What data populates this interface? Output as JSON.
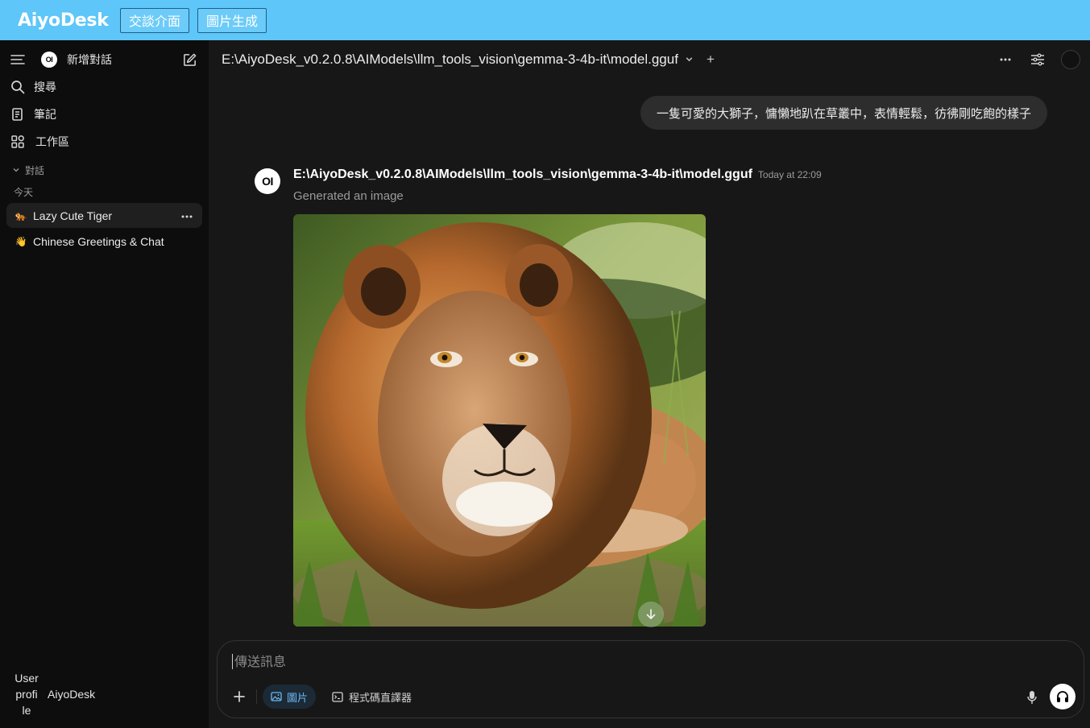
{
  "app": {
    "brand": "AiyoDesk",
    "nav_buttons": [
      "交談介面",
      "圖片生成"
    ]
  },
  "sidebar": {
    "new_chat_label": "新增對話",
    "logo_text": "OI",
    "search_label": "搜尋",
    "notes_label": "筆記",
    "workspace_label": "工作區",
    "conversations_label": "對話",
    "today_label": "今天",
    "chats": [
      {
        "emoji": "🐅",
        "title": "Lazy Cute Tiger",
        "active": true
      },
      {
        "emoji": "👋",
        "title": "Chinese Greetings & Chat",
        "active": false
      }
    ],
    "user": {
      "avatar_alt_lines": [
        "User",
        "profi",
        "le"
      ],
      "name": "AiyoDesk"
    }
  },
  "header": {
    "model_path": "E:\\AiyoDesk_v0.2.0.8\\AIModels\\llm_tools_vision\\gemma-3-4b-it\\model.gguf",
    "add_model_label": "+"
  },
  "messages": {
    "user_text": "一隻可愛的大獅子，慵懶地趴在草叢中，表情輕鬆，彷彿剛吃飽的樣子",
    "assistant": {
      "logo_text": "OI",
      "model_name": "E:\\AiyoDesk_v0.2.0.8\\AIModels\\llm_tools_vision\\gemma-3-4b-it\\model.gguf",
      "timestamp": "Today at 22:09",
      "status": "Generated an image",
      "image_subject": "lion-lying-in-grass"
    }
  },
  "composer": {
    "placeholder": "傳送訊息",
    "image_pill_label": "圖片",
    "code_interpreter_label": "程式碼直譯器"
  },
  "colors": {
    "topbar": "#5ec6f8",
    "sidebar_bg": "#0d0d0d",
    "main_bg": "#171717",
    "pill_accent": "#6db7f0"
  }
}
